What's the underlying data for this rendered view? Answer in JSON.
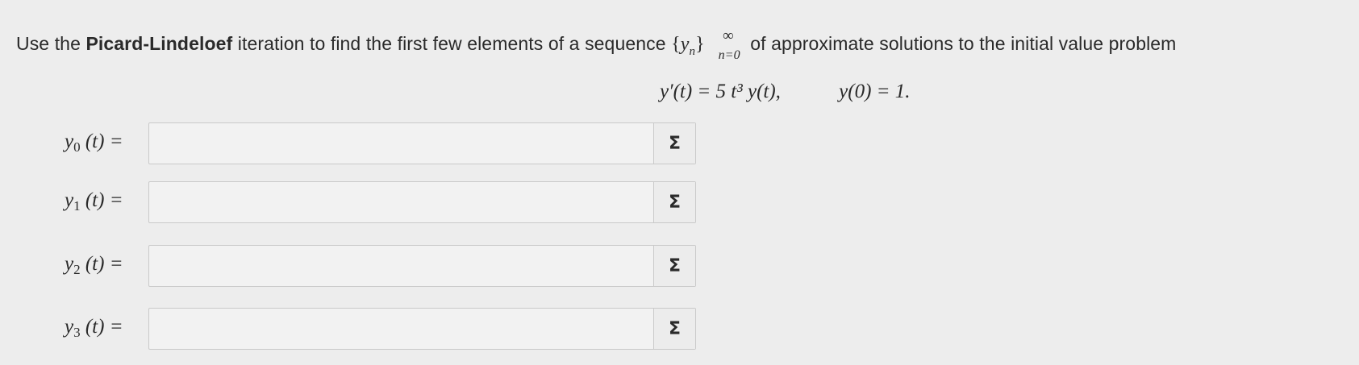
{
  "question": {
    "prefix": "Use the ",
    "method": "Picard-Lindeloef",
    "middle": " iteration to find the first few elements of a sequence",
    "seq_open": "{",
    "seq_var": "y",
    "seq_index": "n",
    "seq_close": "}",
    "seq_sup": "∞",
    "seq_sub": "n=0",
    "suffix": " of approximate solutions to the initial value problem"
  },
  "equation": {
    "main": "y′(t) = 5 t³ y(t),",
    "initial": "y(0) = 1."
  },
  "answers": [
    {
      "label": "y",
      "index": "0",
      "tail": "(t) =",
      "value": "",
      "button": "Σ"
    },
    {
      "label": "y",
      "index": "1",
      "tail": "(t) =",
      "value": "",
      "button": "Σ"
    },
    {
      "label": "y",
      "index": "2",
      "tail": "(t) =",
      "value": "",
      "button": "Σ"
    },
    {
      "label": "y",
      "index": "3",
      "tail": "(t) =",
      "value": "",
      "button": "Σ"
    }
  ]
}
